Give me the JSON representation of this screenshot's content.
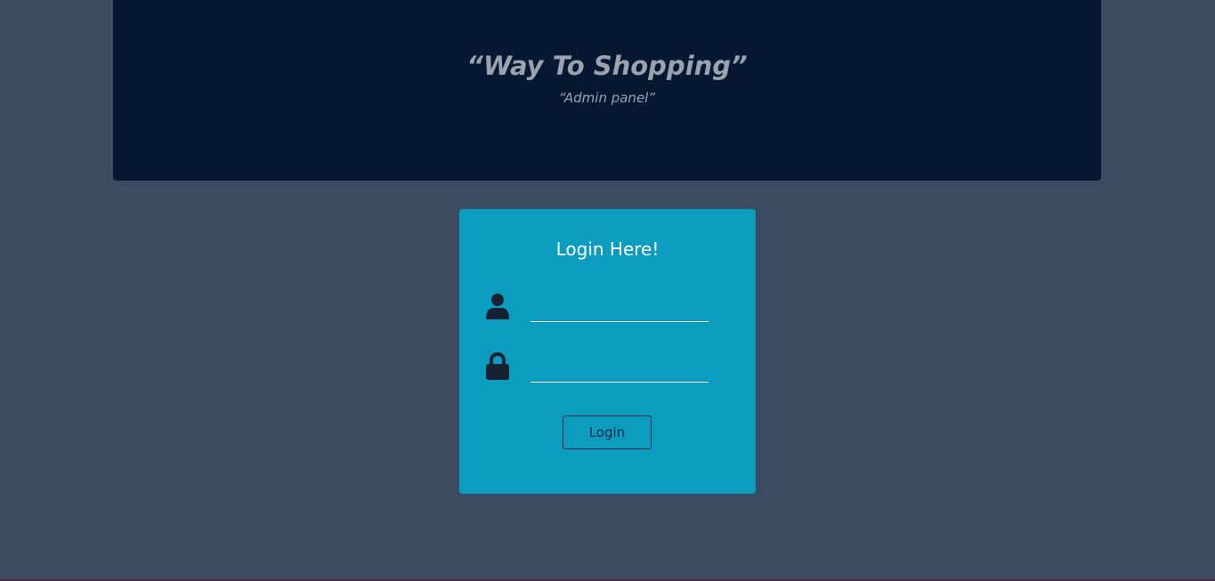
{
  "header": {
    "title": "“Way To Shopping”",
    "subtitle": "“Admin panel”"
  },
  "login": {
    "heading": "Login Here!",
    "username": {
      "icon": "user-icon",
      "value": "",
      "placeholder": ""
    },
    "password": {
      "icon": "lock-icon",
      "value": "",
      "placeholder": ""
    },
    "submit_label": "Login"
  },
  "colors": {
    "page_background": "#3a4b62",
    "header_background": "#071833",
    "card_background": "#0b9cc0",
    "header_text": "#9aa3ad",
    "icon_color": "#152233"
  }
}
